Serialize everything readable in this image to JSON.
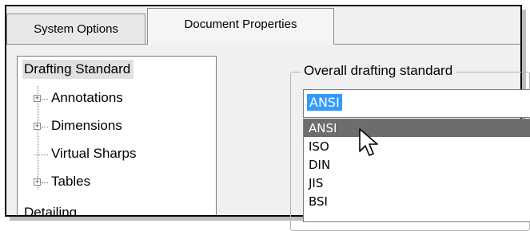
{
  "tabs": [
    {
      "label": "System Options",
      "active": false
    },
    {
      "label": "Document Properties",
      "active": true
    }
  ],
  "tree": {
    "root": "Drafting Standard",
    "items": [
      {
        "label": "Annotations",
        "expandable": true
      },
      {
        "label": "Dimensions",
        "expandable": true
      },
      {
        "label": "Virtual Sharps",
        "expandable": false
      },
      {
        "label": "Tables",
        "expandable": true
      }
    ],
    "next_root": "Detailing"
  },
  "drafting_standard": {
    "group_label": "Overall drafting standard",
    "selected_value": "ANSI",
    "options": [
      "ANSI",
      "ISO",
      "DIN",
      "JIS",
      "BSI"
    ],
    "highlighted_option": "ANSI"
  },
  "colors": {
    "selection_blue": "#3399ff",
    "hover_gray": "#6d6d6d"
  },
  "icons": {
    "expander": "plus-box-icon",
    "pointer": "mouse-pointer-icon"
  }
}
